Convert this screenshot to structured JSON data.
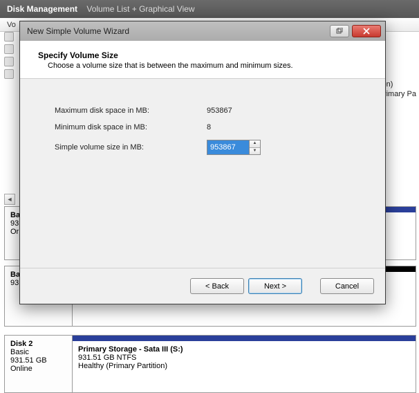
{
  "header": {
    "app": "Disk Management",
    "sub": "Volume List + Graphical View"
  },
  "list_header_fragment": "Vo",
  "right_fragments": {
    "a": "tition)",
    "b": ", Primary Pa"
  },
  "disk_rows": [
    {
      "title_frag": "Ba",
      "line2": "93",
      "line3": "Or"
    },
    {
      "title_frag": "Ba",
      "line2": "93"
    }
  ],
  "disk2": {
    "title": "Disk 2",
    "type": "Basic",
    "size": "931.51 GB",
    "status": "Online",
    "vol_title": "Primary Storage - Sata III  (S:)",
    "vol_line2": "931.51 GB NTFS",
    "vol_line3": "Healthy (Primary Partition)"
  },
  "wizard": {
    "title": "New Simple Volume Wizard",
    "heading": "Specify Volume Size",
    "subheading": "Choose a volume size that is between the maximum and minimum sizes.",
    "rows": {
      "max_label": "Maximum disk space in MB:",
      "max_value": "953867",
      "min_label": "Minimum disk space in MB:",
      "min_value": "8",
      "size_label": "Simple volume size in MB:",
      "size_value": "953867"
    },
    "buttons": {
      "back": "< Back",
      "next": "Next >",
      "cancel": "Cancel"
    }
  }
}
